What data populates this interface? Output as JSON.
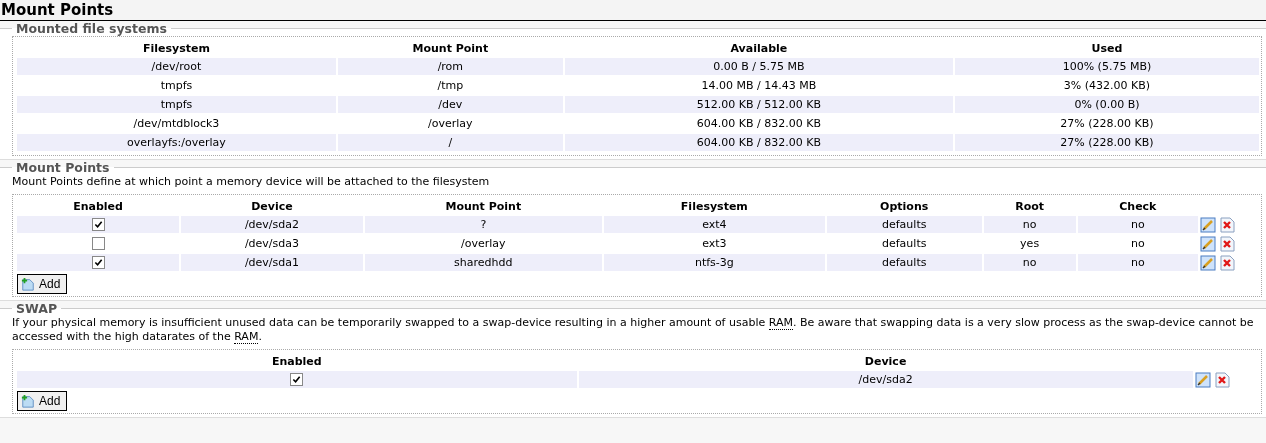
{
  "page_title": "Mount Points",
  "mounted": {
    "legend": "Mounted file systems",
    "columns": [
      "Filesystem",
      "Mount Point",
      "Available",
      "Used"
    ],
    "rows": [
      [
        "/dev/root",
        "/rom",
        "0.00 B / 5.75 MB",
        "100% (5.75 MB)"
      ],
      [
        "tmpfs",
        "/tmp",
        "14.00 MB / 14.43 MB",
        "3% (432.00 KB)"
      ],
      [
        "tmpfs",
        "/dev",
        "512.00 KB / 512.00 KB",
        "0% (0.00 B)"
      ],
      [
        "/dev/mtdblock3",
        "/overlay",
        "604.00 KB / 832.00 KB",
        "27% (228.00 KB)"
      ],
      [
        "overlayfs:/overlay",
        "/",
        "604.00 KB / 832.00 KB",
        "27% (228.00 KB)"
      ]
    ]
  },
  "mounts": {
    "legend": "Mount Points",
    "description": "Mount Points define at which point a memory device will be attached to the filesystem",
    "columns": [
      "Enabled",
      "Device",
      "Mount Point",
      "Filesystem",
      "Options",
      "Root",
      "Check"
    ],
    "rows": [
      {
        "enabled": true,
        "device": "/dev/sda2",
        "mount_point": "?",
        "filesystem": "ext4",
        "options": "defaults",
        "root": "no",
        "check": "no"
      },
      {
        "enabled": false,
        "device": "/dev/sda3",
        "mount_point": "/overlay",
        "filesystem": "ext3",
        "options": "defaults",
        "root": "yes",
        "check": "no"
      },
      {
        "enabled": true,
        "device": "/dev/sda1",
        "mount_point": "sharedhdd",
        "filesystem": "ntfs-3g",
        "options": "defaults",
        "root": "no",
        "check": "no"
      }
    ],
    "add_button": "Add"
  },
  "swap": {
    "legend": "SWAP",
    "description": [
      {
        "kind": "text",
        "text": "If your physical memory is insufficient unused data can be temporarily swapped to a swap-device resulting in a higher amount of usable "
      },
      {
        "kind": "abbr",
        "text": "RAM"
      },
      {
        "kind": "text",
        "text": ". Be aware that swapping data is a very slow process as the swap-device cannot be accessed with the high datarates of the "
      },
      {
        "kind": "abbr",
        "text": "RAM"
      },
      {
        "kind": "text",
        "text": "."
      }
    ],
    "columns": [
      "Enabled",
      "Device"
    ],
    "rows": [
      {
        "enabled": true,
        "device": "/dev/sda2"
      }
    ],
    "add_button": "Add"
  }
}
